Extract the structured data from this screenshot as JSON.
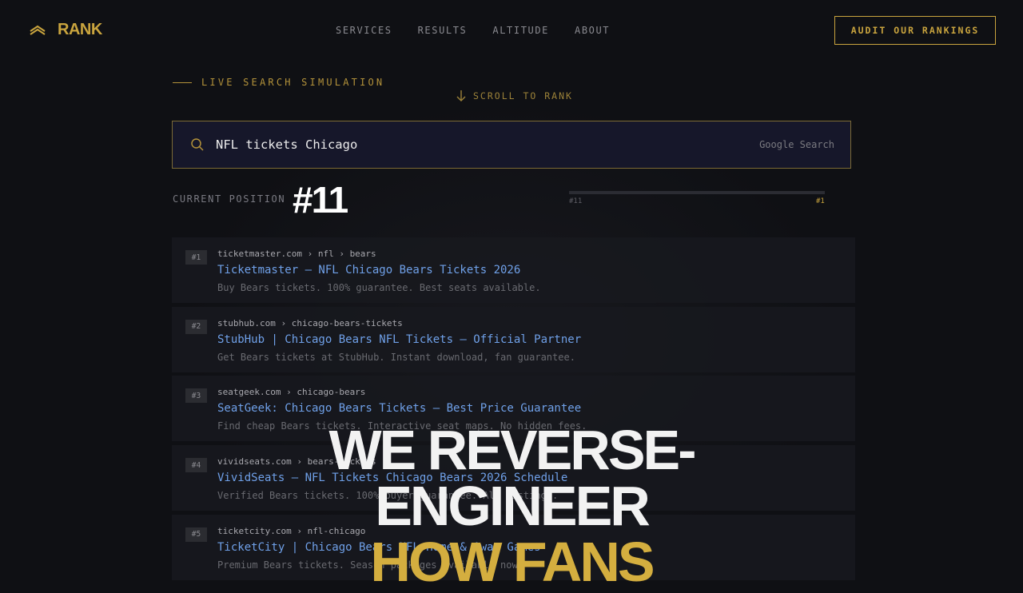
{
  "brand": {
    "name": "RANK",
    "logo_icon": "chevron-stack-icon",
    "accent": "#c9a43e"
  },
  "nav": {
    "items": [
      "SERVICES",
      "RESULTS",
      "ALTITUDE",
      "ABOUT"
    ],
    "cta": "AUDIT OUR RANKINGS"
  },
  "hero": {
    "live_label": "LIVE SEARCH SIMULATION",
    "scroll_hint": "SCROLL TO RANK",
    "search": {
      "query": "NFL tickets Chicago",
      "engine": "Google Search"
    },
    "position": {
      "label": "CURRENT POSITION",
      "value": "#11",
      "progress_percent": 0,
      "range_start": "#11",
      "range_end": "#1"
    },
    "headline": {
      "line1": "WE REVERSE-",
      "line2": "ENGINEER",
      "line3": "HOW FANS"
    }
  },
  "results": [
    {
      "rank": "#1",
      "url": "ticketmaster.com › nfl › bears",
      "title": "Ticketmaster — NFL Chicago Bears Tickets 2026",
      "desc": "Buy Bears tickets. 100% guarantee. Best seats available."
    },
    {
      "rank": "#2",
      "url": "stubhub.com › chicago-bears-tickets",
      "title": "StubHub | Chicago Bears NFL Tickets — Official Partner",
      "desc": "Get Bears tickets at StubHub. Instant download, fan guarantee."
    },
    {
      "rank": "#3",
      "url": "seatgeek.com › chicago-bears",
      "title": "SeatGeek: Chicago Bears Tickets — Best Price Guarantee",
      "desc": "Find cheap Bears tickets. Interactive seat maps. No hidden fees."
    },
    {
      "rank": "#4",
      "url": "vividseats.com › bears-tickets",
      "title": "VividSeats — NFL Tickets Chicago Bears 2026 Schedule",
      "desc": "Verified Bears tickets. 100% buyer guarantee. All listings."
    },
    {
      "rank": "#5",
      "url": "ticketcity.com › nfl-chicago",
      "title": "TicketCity | Chicago Bears NFL Home & Away Games",
      "desc": "Premium Bears tickets. Season packages available now."
    }
  ]
}
